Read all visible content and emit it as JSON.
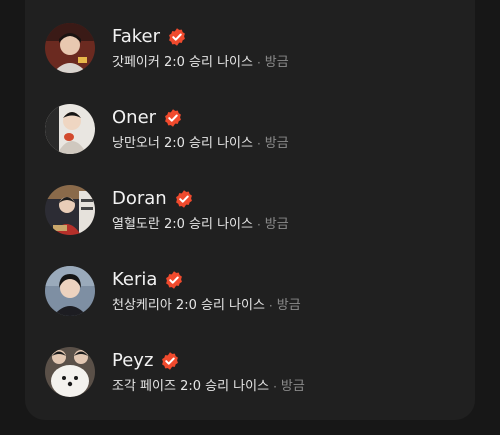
{
  "colors": {
    "background": "#171717",
    "card": "#202020",
    "verified": "#f04a2d",
    "name": "#f2f2f2",
    "muted": "#8a8a8a"
  },
  "comments": [
    {
      "name": "Faker",
      "message": "갓페이커 2:0 승리 나이스",
      "separator": "·",
      "time": "방금",
      "verified": true,
      "avatar_icon": "avatar-photo"
    },
    {
      "name": "Oner",
      "message": "낭만오너 2:0 승리 나이스",
      "separator": "·",
      "time": "방금",
      "verified": true,
      "avatar_icon": "avatar-photo"
    },
    {
      "name": "Doran",
      "message": "열혈도란 2:0 승리 나이스",
      "separator": "·",
      "time": "방금",
      "verified": true,
      "avatar_icon": "avatar-photo"
    },
    {
      "name": "Keria",
      "message": "천상케리아 2:0 승리 나이스",
      "separator": "·",
      "time": "방금",
      "verified": true,
      "avatar_icon": "avatar-photo"
    },
    {
      "name": "Peyz",
      "message": "조각 페이즈 2:0 승리 나이스",
      "separator": "·",
      "time": "방금",
      "verified": true,
      "avatar_icon": "avatar-photo"
    }
  ]
}
